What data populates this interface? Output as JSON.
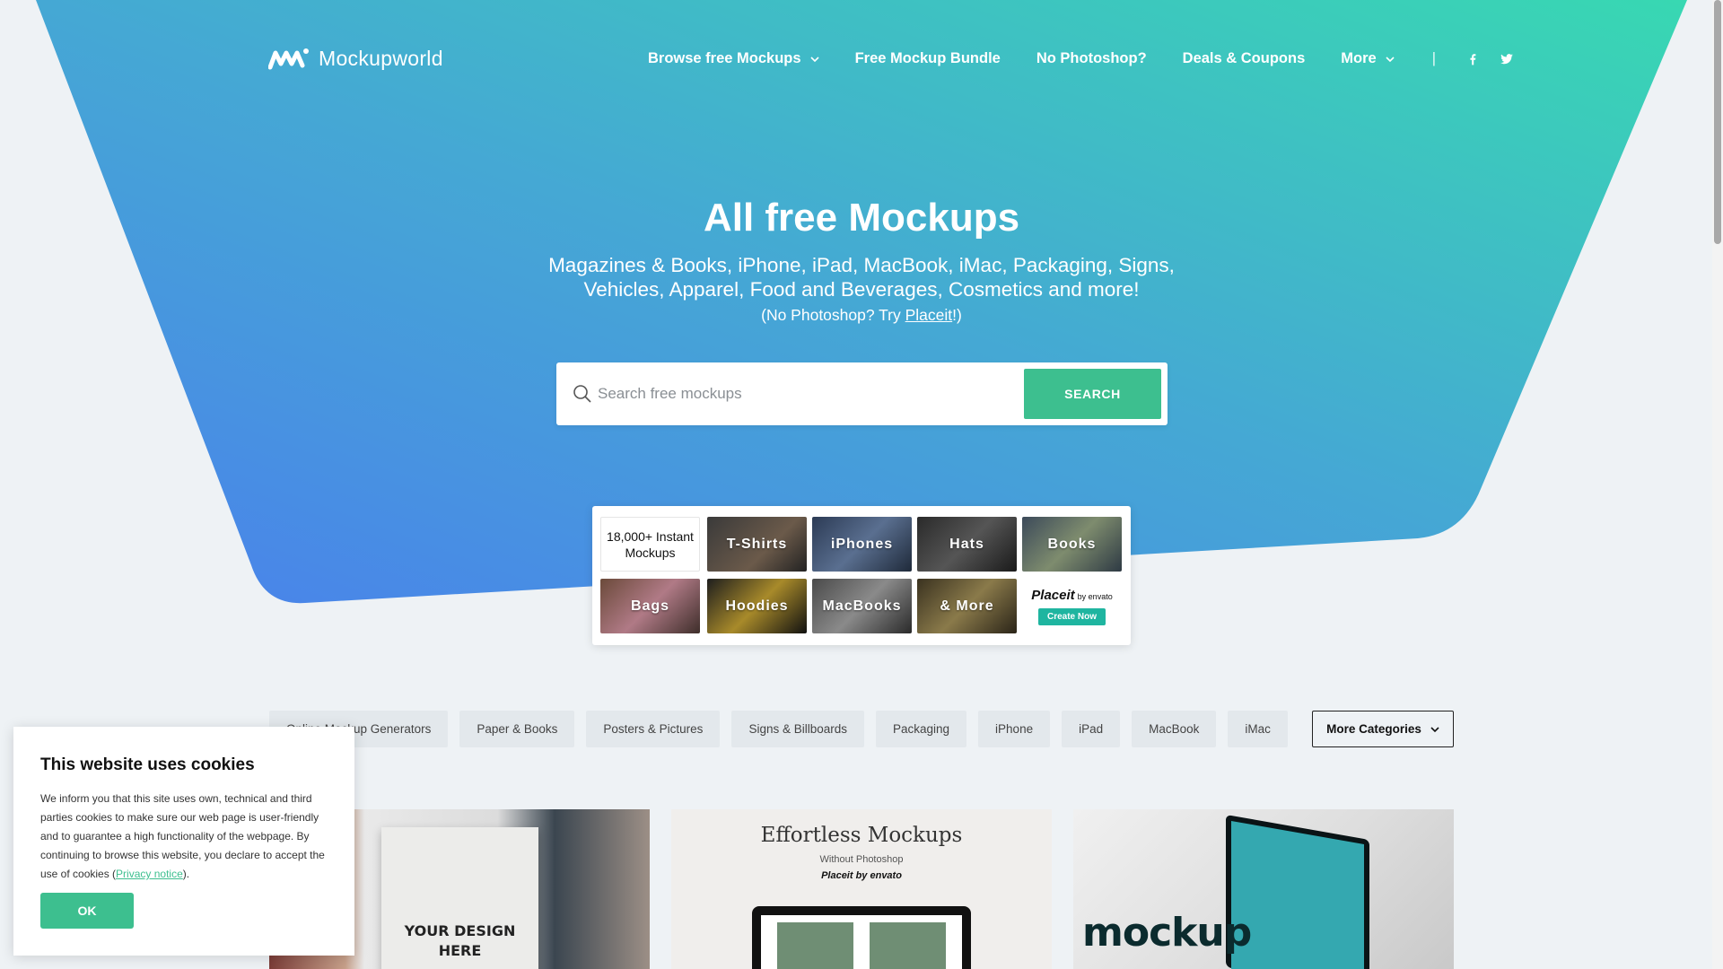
{
  "colors": {
    "accent": "#3dbf8f",
    "hero_start": "#4a86e8",
    "hero_end": "#38d6b4"
  },
  "nav": {
    "logo_text": "Mockupworld",
    "items": [
      {
        "label": "Browse free Mockups",
        "dropdown": true
      },
      {
        "label": "Free Mockup Bundle",
        "dropdown": false
      },
      {
        "label": "No Photoshop?",
        "dropdown": false
      },
      {
        "label": "Deals & Coupons",
        "dropdown": false
      },
      {
        "label": "More",
        "dropdown": true
      }
    ],
    "separator": "|",
    "social": [
      "facebook-icon",
      "twitter-icon"
    ]
  },
  "hero": {
    "title": "All free Mockups",
    "subtitle": "Magazines & Books, iPhone, iPad, MacBook, iMac, Packaging, Signs, Vehicles, Apparel, Food and Beverages, Cosmetics and more!",
    "note_prefix": "(No Photoshop? Try ",
    "note_link": "Placeit",
    "note_suffix": "!)"
  },
  "search": {
    "placeholder": "Search free mockups",
    "button": "SEARCH"
  },
  "placeit": {
    "info": "18,000+ Instant Mockups",
    "tiles": [
      "T-Shirts",
      "iPhones",
      "Hats",
      "Books",
      "Bags",
      "Hoodies",
      "MacBooks",
      "& More"
    ],
    "brand": "Placeit",
    "brand_by": "by envato",
    "cta": "Create Now"
  },
  "categories": [
    "Online Mockup Generators",
    "Paper & Books",
    "Posters & Pictures",
    "Signs & Billboards",
    "Packaging",
    "iPhone",
    "iPad",
    "MacBook",
    "iMac"
  ],
  "more_categories": "More Categories",
  "cards": {
    "card1_text": "YOUR DESIGN HERE",
    "card2_title": "Effortless Mockups",
    "card2_sub": "Without Photoshop",
    "card2_brand": "Placeit by envato",
    "card3_text": "mockup"
  },
  "cookie": {
    "title": "This website uses cookies",
    "text": "We inform you that this site uses own, technical and third parties cookies to make sure our web page is user-friendly and to guarantee a high functionality of the webpage. By continuing to browse this website, you declare to accept the use of cookies (",
    "link": "Privacy notice",
    "text_end": ").",
    "button": "OK"
  }
}
